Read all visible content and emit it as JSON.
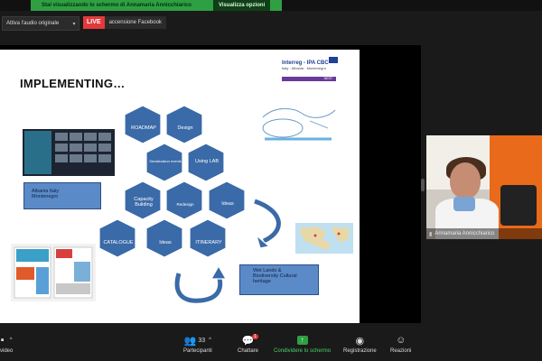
{
  "banner": {
    "message": "Stai visualizzando lo schermo di Annamaria Annicchiarico",
    "options": "Visualizza opzioni"
  },
  "audio": {
    "label": "Attiva l'audio originale"
  },
  "live": {
    "badge": "LIVE",
    "text": "accensione Facebook"
  },
  "slide": {
    "title": "IMPLEMENTING…",
    "logo": {
      "line1": "Interreg - IPA CBC",
      "line2": "Italy · Albania · Montenegro",
      "sub": "NEST"
    },
    "hexagons": [
      {
        "label": "ROADMAP"
      },
      {
        "label": "Design"
      },
      {
        "label": "Sensitization events"
      },
      {
        "label": "Using LAB"
      },
      {
        "label": "Capacity Building"
      },
      {
        "label": "Redesign"
      },
      {
        "label": "Ideas"
      },
      {
        "label": "CATALOGUE"
      },
      {
        "label": "Ideas"
      },
      {
        "label": "ITINERARY"
      }
    ],
    "callouts": {
      "countries": "Albania Italy Montenegro",
      "wetlands": "Wet Lands & Biodiversity Cultural heritage"
    }
  },
  "participant": {
    "name": "Annamaria Annicchiarico"
  },
  "bottom": {
    "video": "video",
    "participants": {
      "label": "Partecipanti",
      "count": "33"
    },
    "chat": {
      "label": "Chattare",
      "badge": "1"
    },
    "share": {
      "label": "Condividere lo schermo"
    },
    "record": {
      "label": "Registrazione"
    },
    "reactions": {
      "label": "Reazioni"
    }
  },
  "colors": {
    "hex": "#3a6aa8",
    "share_green": "#2ea043",
    "live_red": "#e23a3a"
  }
}
